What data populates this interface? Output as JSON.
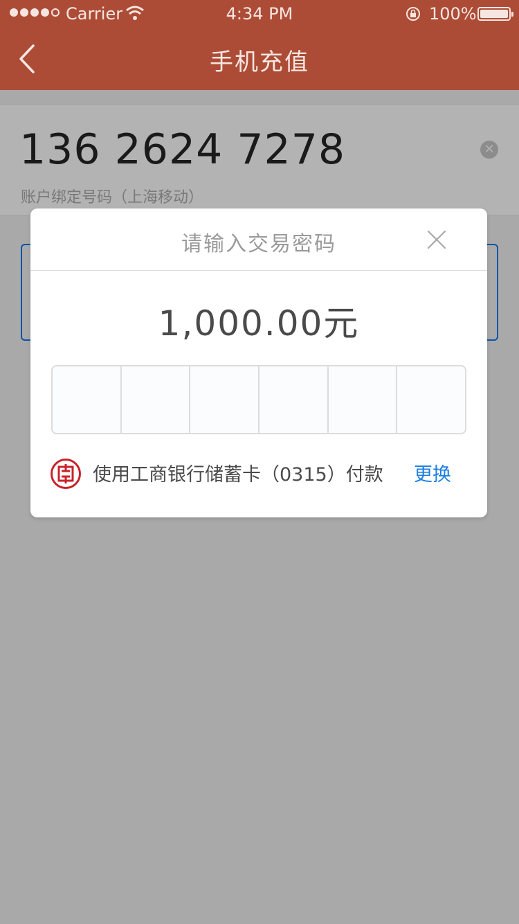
{
  "status_bar": {
    "carrier": "Carrier",
    "time": "4:34 PM",
    "battery": "100%",
    "icons": [
      "signal-dots-icon",
      "wifi-icon",
      "orientation-lock-icon",
      "battery-icon"
    ]
  },
  "nav": {
    "title": "手机充值",
    "back_icon": "chevron-left-icon"
  },
  "phone": {
    "number": "136 2624 7278",
    "subtitle": "账户绑定号码（上海移动）",
    "clear_icon": "clear-icon"
  },
  "modal": {
    "title": "请输入交易密码",
    "close_icon": "close-icon",
    "amount": "1,000.00元",
    "pin_length": 6,
    "payment_text": "使用工商银行储蓄卡（0315）付款",
    "change_label": "更换",
    "bank_icon": "icbc-logo-icon"
  },
  "colors": {
    "header_bg": "#ad4c36",
    "overlay_bg": "#a9a9a9",
    "link": "#1e7ee4",
    "bank_red": "#c8222a"
  }
}
